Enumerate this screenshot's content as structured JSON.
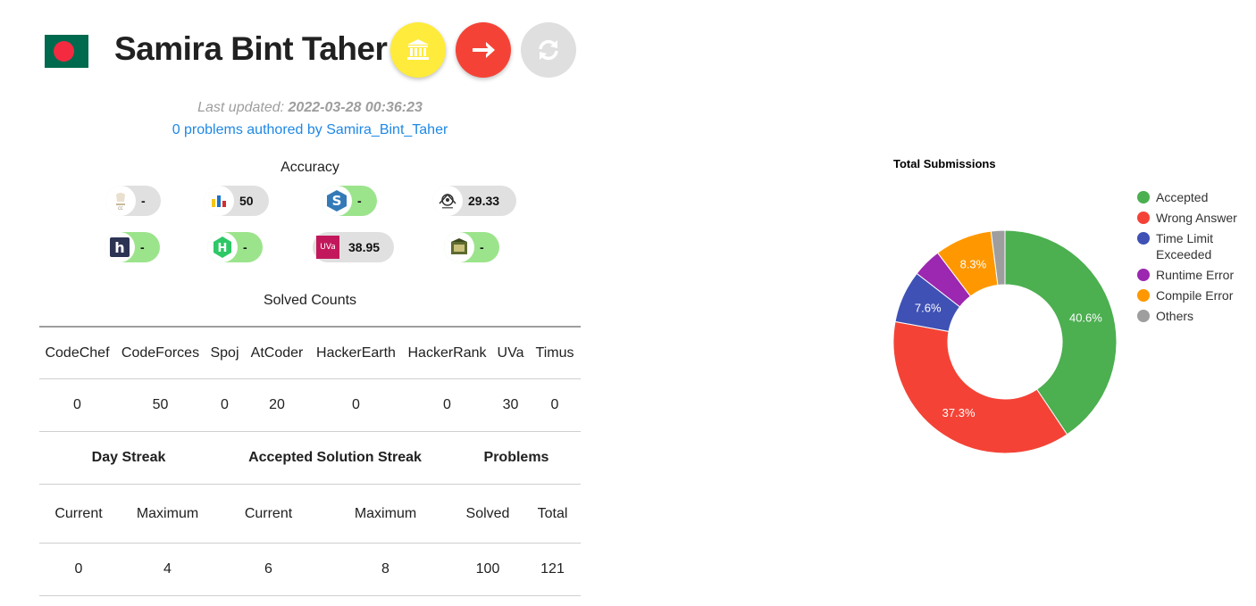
{
  "profile": {
    "name": "Samira Bint Taher",
    "last_updated_label": "Last updated:",
    "last_updated_value": "2022-03-28 00:36:23",
    "authored_link": "0 problems authored by Samira_Bint_Taher",
    "colors": {
      "flag_green": "#006a4e",
      "flag_red": "#f42a41",
      "link": "#1e88e5"
    }
  },
  "actions": {
    "institution_icon": "bank-icon",
    "compare_icon": "arrow-right-icon",
    "refresh_icon": "refresh-icon"
  },
  "accuracy": {
    "title": "Accuracy",
    "chips": [
      {
        "site": "CodeChef",
        "value": "-",
        "status": "grey"
      },
      {
        "site": "CodeForces",
        "value": "50",
        "status": "grey"
      },
      {
        "site": "Spoj",
        "value": "-",
        "status": "green"
      },
      {
        "site": "AtCoder",
        "value": "29.33",
        "status": "grey"
      },
      {
        "site": "HackerEarth",
        "value": "-",
        "status": "green"
      },
      {
        "site": "HackerRank",
        "value": "-",
        "status": "green"
      },
      {
        "site": "UVa",
        "value": "38.95",
        "status": "grey",
        "logo_text": "UVa"
      },
      {
        "site": "Timus",
        "value": "-",
        "status": "green"
      }
    ]
  },
  "solved_counts": {
    "title": "Solved Counts",
    "headers": [
      "CodeChef",
      "CodeForces",
      "Spoj",
      "AtCoder",
      "HackerEarth",
      "HackerRank",
      "UVa",
      "Timus"
    ],
    "values": [
      "0",
      "50",
      "0",
      "20",
      "0",
      "0",
      "30",
      "0"
    ]
  },
  "streaks": {
    "groups": [
      "Day Streak",
      "Accepted Solution Streak",
      "Problems"
    ],
    "subheaders": [
      "Current",
      "Maximum",
      "Current",
      "Maximum",
      "Solved",
      "Total"
    ],
    "values": [
      "0",
      "4",
      "6",
      "8",
      "100",
      "121"
    ]
  },
  "chart_data": {
    "type": "pie",
    "title": "Total Submissions",
    "donut": true,
    "legend_position": "right",
    "categories": [
      "Accepted",
      "Wrong Answer",
      "Time Limit Exceeded",
      "Runtime Error",
      "Compile Error",
      "Others"
    ],
    "values": [
      40.6,
      37.3,
      7.6,
      4.2,
      8.3,
      2.0
    ],
    "labels": [
      "40.6%",
      "37.3%",
      "7.6%",
      "",
      "8.3%",
      ""
    ],
    "colors": [
      "#4caf50",
      "#f44336",
      "#3f51b5",
      "#9c27b0",
      "#ff9800",
      "#9e9e9e"
    ],
    "legend": [
      "Accepted",
      "Wrong Answer",
      "Time Limit",
      "Exceeded",
      "Runtime Error",
      "Compile Error",
      "Others"
    ]
  }
}
